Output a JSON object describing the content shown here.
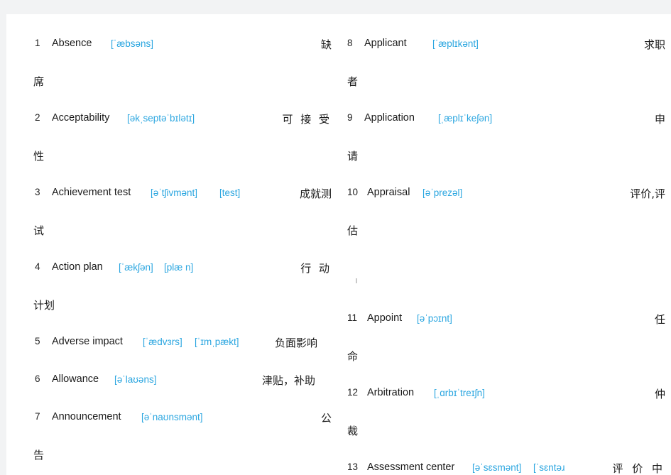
{
  "document": {
    "title": "English-Chinese HR Vocabulary List",
    "accent_color": "#2ba6e0",
    "text_color": "#1a1a1a",
    "page_background": "#ffffff",
    "canvas_background": "#f2f3f4"
  },
  "columns": {
    "left": {
      "entries": [
        {
          "number": "1",
          "term": "Absence",
          "ipa": "[ˈæbsəns]",
          "ipa2": "",
          "chinese": "缺",
          "chinese_continuation": "席"
        },
        {
          "number": "2",
          "term": "Acceptability",
          "ipa": "[əkˌseptəˈbɪlətɪ]",
          "ipa2": "",
          "chinese": "可 接 受",
          "chinese_continuation": "性"
        },
        {
          "number": "3",
          "term": "Achievement test",
          "ipa": "[əˈtʃivmənt]",
          "ipa2": "[test]",
          "chinese": "成就测",
          "chinese_continuation": "试"
        },
        {
          "number": "4",
          "term": "Action plan",
          "ipa": "[ˈækʃən]",
          "ipa2": "[plæ n]",
          "chinese": "行 动",
          "chinese_continuation": "计划"
        },
        {
          "number": "5",
          "term": "Adverse impact",
          "ipa": "[ˈædvɜrs]",
          "ipa2": "[ˈɪmˌpækt]",
          "chinese": "负面影响",
          "chinese_continuation": ""
        },
        {
          "number": "6",
          "term": "Allowance",
          "ipa": "[əˈlaʊəns]",
          "ipa2": "",
          "chinese": "津贴，补助",
          "chinese_continuation": ""
        },
        {
          "number": "7",
          "term": "Announcement",
          "ipa": "[əˈnaʊnsmənt]",
          "ipa2": "",
          "chinese": "公",
          "chinese_continuation": "告"
        }
      ]
    },
    "right": {
      "entries": [
        {
          "number": "8",
          "term": "Applicant",
          "ipa": "[ˈæplɪkənt]",
          "ipa2": "",
          "chinese": "求职",
          "chinese_continuation": "者"
        },
        {
          "number": "9",
          "term": "Application",
          "ipa": "[ˌæplɪˈkeʃən]",
          "ipa2": "",
          "chinese": "申",
          "chinese_continuation": "请"
        },
        {
          "number": "10",
          "term": "Appraisal",
          "ipa": "[əˈprezəl]",
          "ipa2": "",
          "chinese": "评价,评",
          "chinese_continuation": "估"
        },
        {
          "number": "11",
          "term": "Appoint",
          "ipa": "[əˈpɔɪnt]",
          "ipa2": "",
          "chinese": "任",
          "chinese_continuation": "命"
        },
        {
          "number": "12",
          "term": "Arbitration",
          "ipa": "[ˌɑrbɪˈtreɪʃn]",
          "ipa2": "",
          "chinese": "仲",
          "chinese_continuation": "裁"
        },
        {
          "number": "13",
          "term": "Assessment center",
          "ipa": "[əˈsɛsmənt]",
          "ipa2": "[ˈsɛntəɹ",
          "chinese": "评 价 中",
          "chinese_continuation": ""
        }
      ]
    }
  }
}
